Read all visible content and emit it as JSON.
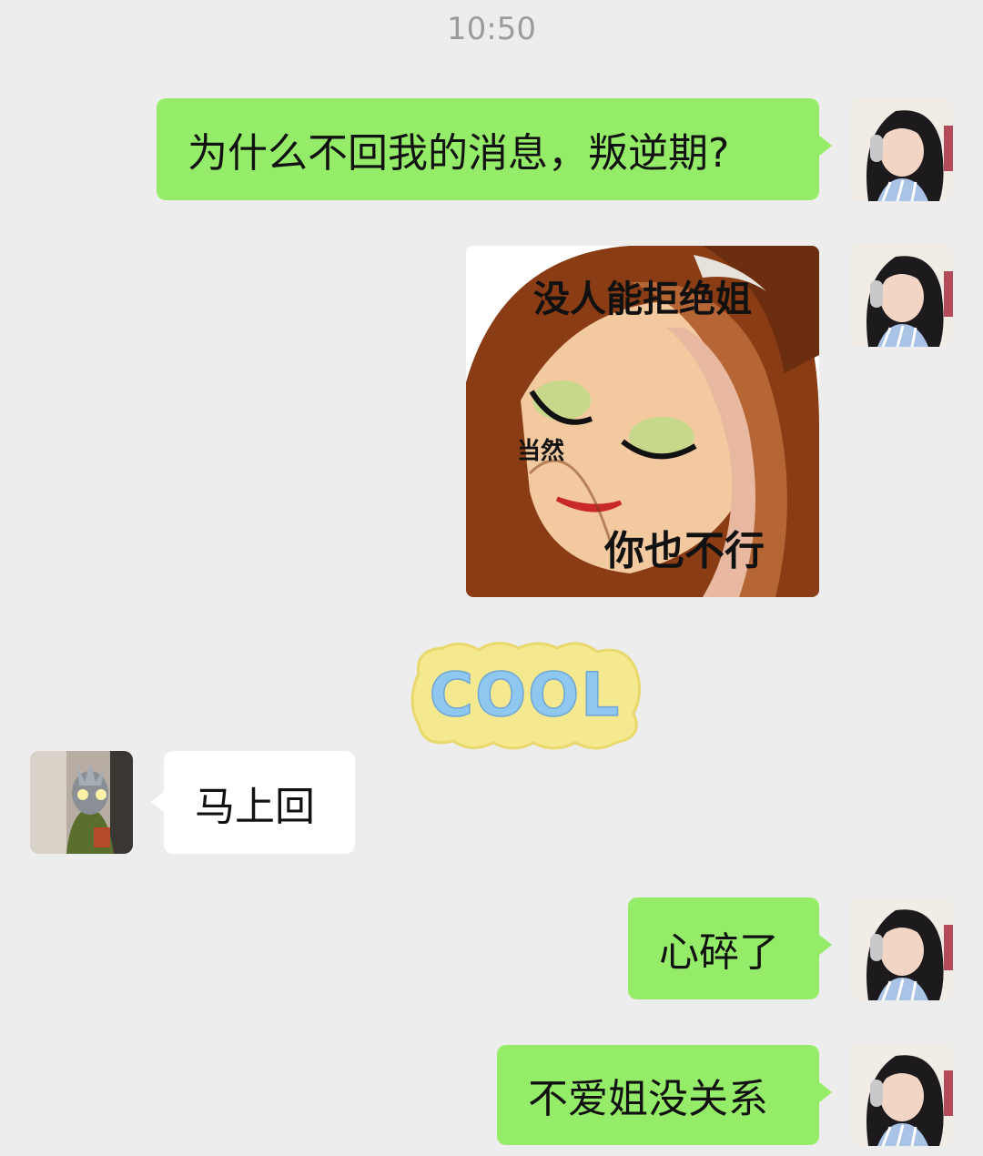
{
  "status": {
    "time": "10:50"
  },
  "messages": [
    {
      "side": "out",
      "type": "text",
      "text": "为什么不回我的消息，叛逆期?"
    },
    {
      "side": "out",
      "type": "sticker",
      "sticker": "meme-woman-eyes-closed",
      "caption_top": "没人能拒绝姐",
      "caption_mid": "当然",
      "caption_bottom": "你也不行"
    },
    {
      "side": "out",
      "type": "sticker",
      "sticker": "cool-clay-sticker",
      "caption": "COOL"
    },
    {
      "side": "in",
      "type": "text",
      "text": "马上回"
    },
    {
      "side": "out",
      "type": "text",
      "text": "心碎了"
    },
    {
      "side": "out",
      "type": "text",
      "text": "不爱姐没关系"
    }
  ],
  "colors": {
    "background": "#ededed",
    "outgoing_bubble": "#95ec69",
    "incoming_bubble": "#ffffff",
    "timestamp": "#9b9b9b"
  },
  "icons": {
    "self_avatar": "girl-headphones-avatar",
    "peer_avatar": "masked-figure-avatar"
  }
}
